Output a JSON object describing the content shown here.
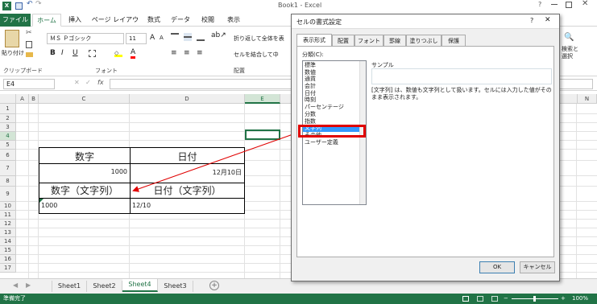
{
  "window": {
    "title": "Book1 - Excel"
  },
  "ribbon_tabs": [
    {
      "label": "ファイル"
    },
    {
      "label": "ホーム"
    },
    {
      "label": "挿入"
    },
    {
      "label": "ページ レイアウト"
    },
    {
      "label": "数式"
    },
    {
      "label": "データ"
    },
    {
      "label": "校閲"
    },
    {
      "label": "表示"
    }
  ],
  "ribbon": {
    "paste_label": "貼り付け",
    "font_name": "ＭＳ Ｐゴシック",
    "font_size": "11",
    "wrap_text": "折り返して全体を表",
    "merge_center": "セルを結合して中",
    "find_select": "検索と\n選択",
    "groups": {
      "clipboard": "クリップボード",
      "font": "フォント",
      "alignment": "配置"
    }
  },
  "formula_bar": {
    "name_box": "E4",
    "fx": "fx"
  },
  "columns": [
    "A",
    "B",
    "C",
    "D",
    "E",
    "N"
  ],
  "rows": [
    "1",
    "2",
    "3",
    "4",
    "5",
    "6",
    "7",
    "8",
    "9",
    "10",
    "11",
    "12",
    "13",
    "14",
    "15",
    "16",
    "17"
  ],
  "table": {
    "h1": "数字",
    "h2": "日付",
    "v1": "1000",
    "v2": "12月10日",
    "h3": "数字（文字列）",
    "h4": "日付（文字列）",
    "v3": "1000",
    "v4": "12/10"
  },
  "sheets": [
    {
      "label": "Sheet1"
    },
    {
      "label": "Sheet2"
    },
    {
      "label": "Sheet4"
    },
    {
      "label": "Sheet3"
    }
  ],
  "active_sheet": "Sheet4",
  "status": {
    "text": "準備完了",
    "zoom": "100%"
  },
  "dialog": {
    "title": "セルの書式設定",
    "tabs": [
      {
        "label": "表示形式"
      },
      {
        "label": "配置"
      },
      {
        "label": "フォント"
      },
      {
        "label": "罫線"
      },
      {
        "label": "塗りつぶし"
      },
      {
        "label": "保護"
      }
    ],
    "category_label": "分類(C):",
    "categories": [
      {
        "label": "標準"
      },
      {
        "label": "数値"
      },
      {
        "label": "通貨"
      },
      {
        "label": "会計"
      },
      {
        "label": "日付"
      },
      {
        "label": "時刻"
      },
      {
        "label": "パーセンテージ"
      },
      {
        "label": "分数"
      },
      {
        "label": "指数"
      },
      {
        "label": "文字列"
      },
      {
        "label": "その他"
      },
      {
        "label": "ユーザー定義"
      }
    ],
    "selected": "文字列",
    "sample_label": "サンプル",
    "description": "[文字列] は、数値も文字列として扱います。セルには入力した値がそのまま表示されます。",
    "ok": "OK",
    "cancel": "キャンセル"
  },
  "colors": {
    "excel_green": "#217346",
    "highlight": "#e00000",
    "selection": "#3399ff"
  }
}
